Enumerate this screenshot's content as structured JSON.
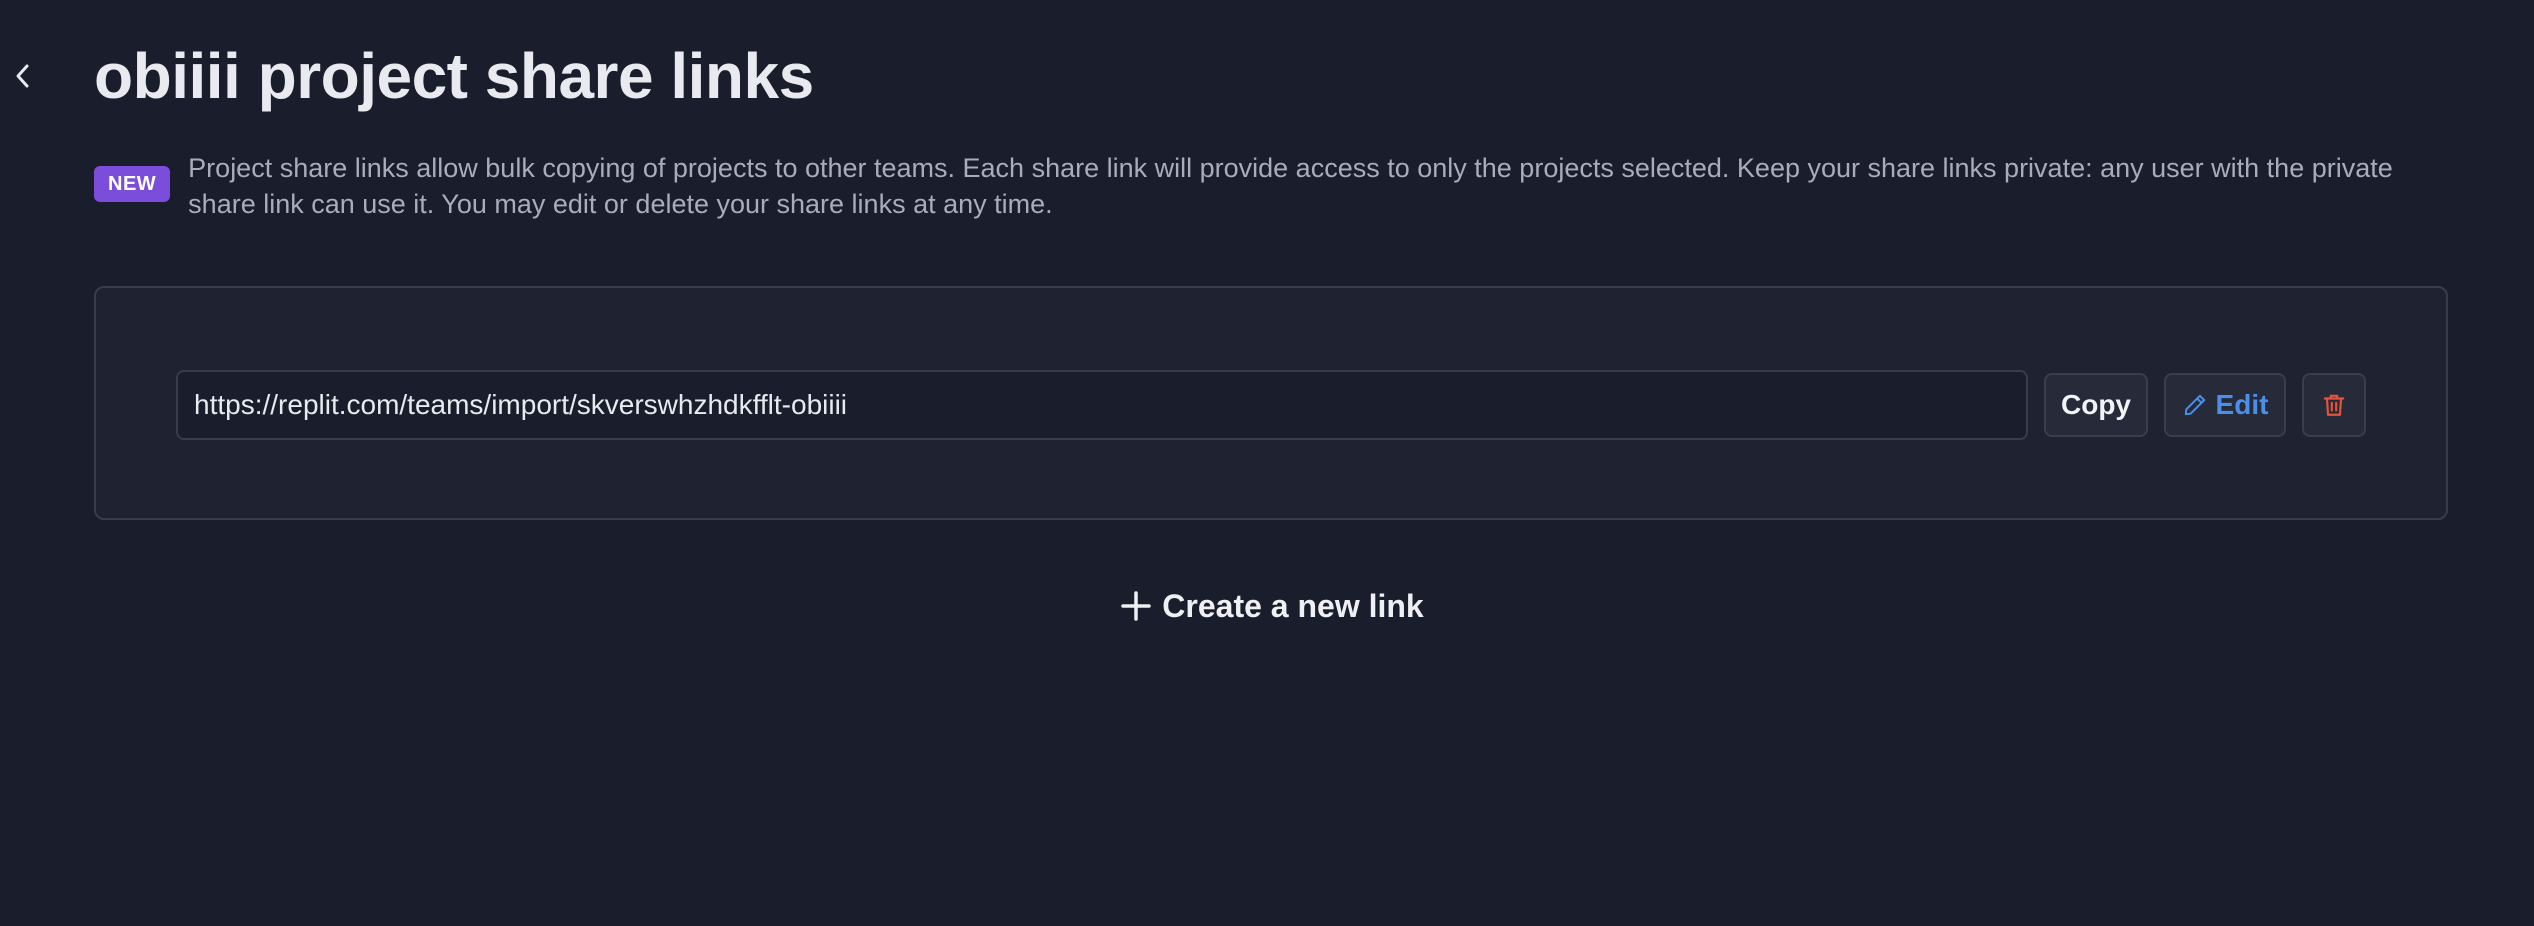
{
  "header": {
    "title": "obiiii project share links",
    "back_icon": "chevron-left-icon"
  },
  "intro": {
    "badge": "NEW",
    "description": "Project share links allow bulk copying of projects to other teams. Each share link will provide access to only the projects selected. Keep your share links private: any user with the private share link can use it. You may edit or delete your share links at any time."
  },
  "share_links": [
    {
      "url": "https://replit.com/teams/import/skverswhzhdkfflt-obiiii",
      "copy_label": "Copy",
      "edit_label": "Edit",
      "edit_icon": "pencil-icon",
      "delete_icon": "trash-icon"
    }
  ],
  "create": {
    "label": "Create a new link",
    "icon": "plus-icon"
  },
  "colors": {
    "background": "#1a1d2b",
    "card": "#1f2231",
    "badge": "#7c4dda",
    "edit_accent": "#4b8fe8",
    "delete_accent": "#e5533d"
  }
}
